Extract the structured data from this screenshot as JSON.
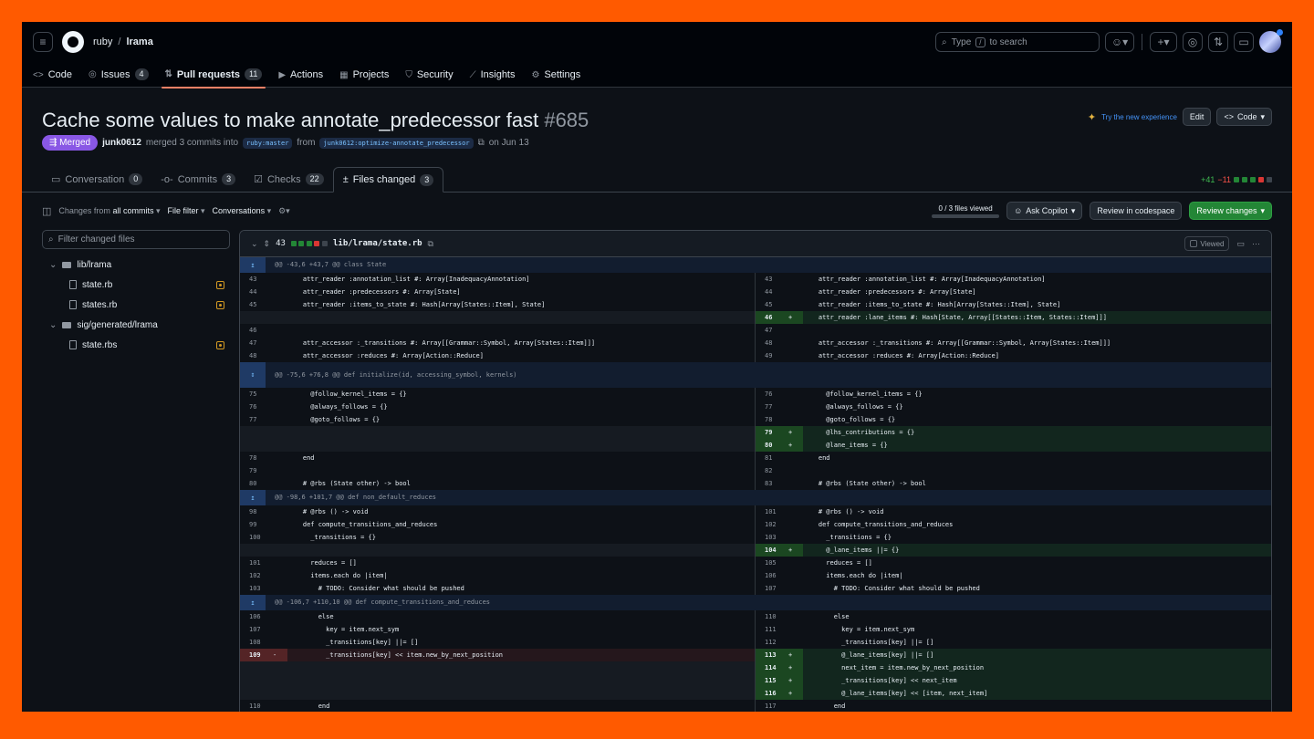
{
  "repo": {
    "owner": "ruby",
    "name": "lrama"
  },
  "search": {
    "placeholder_pre": "Type",
    "key": "/",
    "placeholder_post": "to search"
  },
  "nav": [
    {
      "label": "Code",
      "icon": "<>"
    },
    {
      "label": "Issues",
      "icon": "◎",
      "count": "4"
    },
    {
      "label": "Pull requests",
      "icon": "⇅",
      "count": "11"
    },
    {
      "label": "Actions",
      "icon": "▶"
    },
    {
      "label": "Projects",
      "icon": "▦"
    },
    {
      "label": "Security",
      "icon": "⛉"
    },
    {
      "label": "Insights",
      "icon": "⟋"
    },
    {
      "label": "Settings",
      "icon": "⚙"
    }
  ],
  "pr": {
    "title": "Cache some values to make annotate_predecessor fast",
    "number": "#685",
    "status": "Merged",
    "author": "junk0612",
    "merge_text": "merged 3 commits into",
    "base": "ruby:master",
    "from_text": "from",
    "head": "junk0612:optimize-annotate_predecessor",
    "date": "on Jun 13"
  },
  "actions": {
    "try_new": "Try the new experience",
    "edit": "Edit",
    "code": "Code"
  },
  "tabs": [
    {
      "label": "Conversation",
      "count": "0",
      "icon": "▭"
    },
    {
      "label": "Commits",
      "count": "3",
      "icon": "-o-"
    },
    {
      "label": "Checks",
      "count": "22",
      "icon": "☑"
    },
    {
      "label": "Files changed",
      "count": "3",
      "icon": "±"
    }
  ],
  "diffstat": {
    "add": "+41",
    "del": "−11"
  },
  "toolbar": {
    "changes_from": "Changes from",
    "all_commits": "all commits",
    "file_filter": "File filter",
    "conversations": "Conversations",
    "files_viewed": "0 / 3 files viewed",
    "ask_copilot": "Ask Copilot",
    "review_codespace": "Review in codespace",
    "review_changes": "Review changes"
  },
  "tree": {
    "filter_placeholder": "Filter changed files",
    "items": [
      {
        "type": "folder",
        "label": "lib/lrama"
      },
      {
        "type": "file",
        "label": "state.rb"
      },
      {
        "type": "file",
        "label": "states.rb"
      },
      {
        "type": "folder",
        "label": "sig/generated/lrama"
      },
      {
        "type": "file",
        "label": "state.rbs"
      }
    ]
  },
  "diff": {
    "count": "43",
    "path": "lib/lrama/state.rb",
    "viewed": "Viewed",
    "rows": [
      {
        "t": "hunk",
        "text": "@@ -43,6 +43,7 @@ class State"
      },
      {
        "t": "line",
        "l": [
          "43",
          "",
          "    attr_reader :annotation_list #: Array[InadequacyAnnotation]"
        ],
        "r": [
          "43",
          "",
          "    attr_reader :annotation_list #: Array[InadequacyAnnotation]"
        ]
      },
      {
        "t": "line",
        "l": [
          "44",
          "",
          "    attr_reader :predecessors #: Array[State]"
        ],
        "r": [
          "44",
          "",
          "    attr_reader :predecessors #: Array[State]"
        ]
      },
      {
        "t": "line",
        "l": [
          "45",
          "",
          "    attr_reader :items_to_state #: Hash[Array[States::Item], State]"
        ],
        "r": [
          "45",
          "",
          "    attr_reader :items_to_state #: Hash[Array[States::Item], State]"
        ]
      },
      {
        "t": "line",
        "l": null,
        "r": [
          "46",
          "+",
          "    attr_reader :lane_items #: Hash[State, Array[[States::Item, States::Item]]]"
        ],
        "rc": "add"
      },
      {
        "t": "line",
        "l": [
          "46",
          "",
          ""
        ],
        "r": [
          "47",
          "",
          ""
        ]
      },
      {
        "t": "line",
        "l": [
          "47",
          "",
          "    attr_accessor :_transitions #: Array[[Grammar::Symbol, Array[States::Item]]]"
        ],
        "r": [
          "48",
          "",
          "    attr_accessor :_transitions #: Array[[Grammar::Symbol, Array[States::Item]]]"
        ]
      },
      {
        "t": "line",
        "l": [
          "48",
          "",
          "    attr_accessor :reduces #: Array[Action::Reduce]"
        ],
        "r": [
          "49",
          "",
          "    attr_accessor :reduces #: Array[Action::Reduce]"
        ]
      },
      {
        "t": "hunk",
        "tall": true,
        "text": "@@ -75,6 +76,8 @@ def initialize(id, accessing_symbol, kernels)"
      },
      {
        "t": "line",
        "l": [
          "75",
          "",
          "      @follow_kernel_items = {}"
        ],
        "r": [
          "76",
          "",
          "      @follow_kernel_items = {}"
        ]
      },
      {
        "t": "line",
        "l": [
          "76",
          "",
          "      @always_follows = {}"
        ],
        "r": [
          "77",
          "",
          "      @always_follows = {}"
        ]
      },
      {
        "t": "line",
        "l": [
          "77",
          "",
          "      @goto_follows = {}"
        ],
        "r": [
          "78",
          "",
          "      @goto_follows = {}"
        ]
      },
      {
        "t": "line",
        "l": null,
        "r": [
          "79",
          "+",
          "      @lhs_contributions = {}"
        ],
        "rc": "add"
      },
      {
        "t": "line",
        "l": null,
        "r": [
          "80",
          "+",
          "      @lane_items = {}"
        ],
        "rc": "add"
      },
      {
        "t": "line",
        "l": [
          "78",
          "",
          "    end"
        ],
        "r": [
          "81",
          "",
          "    end"
        ]
      },
      {
        "t": "line",
        "l": [
          "79",
          "",
          ""
        ],
        "r": [
          "82",
          "",
          ""
        ]
      },
      {
        "t": "line",
        "l": [
          "80",
          "",
          "    # @rbs (State other) -> bool"
        ],
        "r": [
          "83",
          "",
          "    # @rbs (State other) -> bool"
        ]
      },
      {
        "t": "hunk",
        "text": "@@ -98,6 +101,7 @@ def non_default_reduces"
      },
      {
        "t": "line",
        "l": [
          "98",
          "",
          "    # @rbs () -> void"
        ],
        "r": [
          "101",
          "",
          "    # @rbs () -> void"
        ]
      },
      {
        "t": "line",
        "l": [
          "99",
          "",
          "    def compute_transitions_and_reduces"
        ],
        "r": [
          "102",
          "",
          "    def compute_transitions_and_reduces"
        ]
      },
      {
        "t": "line",
        "l": [
          "100",
          "",
          "      _transitions = {}"
        ],
        "r": [
          "103",
          "",
          "      _transitions = {}"
        ]
      },
      {
        "t": "line",
        "l": null,
        "r": [
          "104",
          "+",
          "      @_lane_items ||= {}"
        ],
        "rc": "add"
      },
      {
        "t": "line",
        "l": [
          "101",
          "",
          "      reduces = []"
        ],
        "r": [
          "105",
          "",
          "      reduces = []"
        ]
      },
      {
        "t": "line",
        "l": [
          "102",
          "",
          "      items.each do |item|"
        ],
        "r": [
          "106",
          "",
          "      items.each do |item|"
        ]
      },
      {
        "t": "line",
        "l": [
          "103",
          "",
          "        # TODO: Consider what should be pushed"
        ],
        "r": [
          "107",
          "",
          "        # TODO: Consider what should be pushed"
        ]
      },
      {
        "t": "hunk",
        "text": "@@ -106,7 +110,10 @@ def compute_transitions_and_reduces"
      },
      {
        "t": "line",
        "l": [
          "106",
          "",
          "        else"
        ],
        "r": [
          "110",
          "",
          "        else"
        ]
      },
      {
        "t": "line",
        "l": [
          "107",
          "",
          "          key = item.next_sym"
        ],
        "r": [
          "111",
          "",
          "          key = item.next_sym"
        ]
      },
      {
        "t": "line",
        "l": [
          "108",
          "",
          "          _transitions[key] ||= []"
        ],
        "r": [
          "112",
          "",
          "          _transitions[key] ||= []"
        ]
      },
      {
        "t": "line",
        "l": [
          "109",
          "-",
          "          _transitions[key] << item.new_by_next_position"
        ],
        "lc": "del",
        "r": [
          "113",
          "+",
          "          @_lane_items[key] ||= []"
        ],
        "rc": "add"
      },
      {
        "t": "line",
        "l": null,
        "r": [
          "114",
          "+",
          "          next_item = item.new_by_next_position"
        ],
        "rc": "add"
      },
      {
        "t": "line",
        "l": null,
        "r": [
          "115",
          "+",
          "          _transitions[key] << next_item"
        ],
        "rc": "add"
      },
      {
        "t": "line",
        "l": null,
        "r": [
          "116",
          "+",
          "          @_lane_items[key] << [item, next_item]"
        ],
        "rc": "add"
      },
      {
        "t": "line",
        "l": [
          "110",
          "",
          "        end"
        ],
        "r": [
          "117",
          "",
          "        end"
        ]
      }
    ]
  },
  "colors": {
    "accent": "#f78166",
    "merged": "#8957e5",
    "add": "#238636",
    "del": "#da3633",
    "frame": "#ff5a00"
  }
}
